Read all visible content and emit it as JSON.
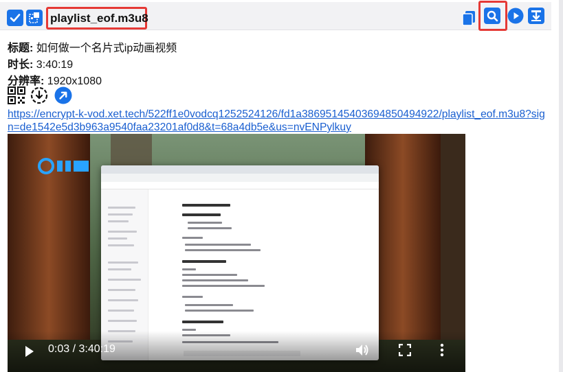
{
  "header": {
    "filename": "playlist_eof.m3u8",
    "icons": [
      "checkbox-checked-icon",
      "extension-icon",
      "copy-icon",
      "search-icon",
      "play-icon",
      "download-icon"
    ]
  },
  "info": {
    "title_label": "标题:",
    "title_value": "如何做一个名片式ip动画视频",
    "duration_label": "时长:",
    "duration_value": "3:40:19",
    "resolution_label": "分辨率:",
    "resolution_value": "1920x1080",
    "icons": [
      "qrcode-icon",
      "download-circle-icon",
      "open-external-icon"
    ]
  },
  "link": {
    "url": "https://encrypt-k-vod.xet.tech/522ff1e0vodcq1252524126/fd1a3869514540369485049492​2/playlist_eof.m3u8?sign=de1542e5d3b963a9540faa23201af0d8&t=68a4db5e&us=nvENPylkuy",
    "text": "https://encrypt-k-vod.xet.tech/522ff1e0vodcq1252524126/fd1a38695145403694850494922/playlist_eof.m3u8?sign=de1542e5d3b963a9540faa23201af0d8&t=68a4db5e&us=nvENPylkuy"
  },
  "video": {
    "time_display": "0:03 / 3:40:19",
    "progress_fraction": 0.0002,
    "controls": [
      "play-icon",
      "volume-icon",
      "fullscreen-icon",
      "more-options-icon"
    ]
  },
  "colors": {
    "accent": "#1a73e8",
    "highlight": "#e53935",
    "link": "#1a5fd0"
  }
}
